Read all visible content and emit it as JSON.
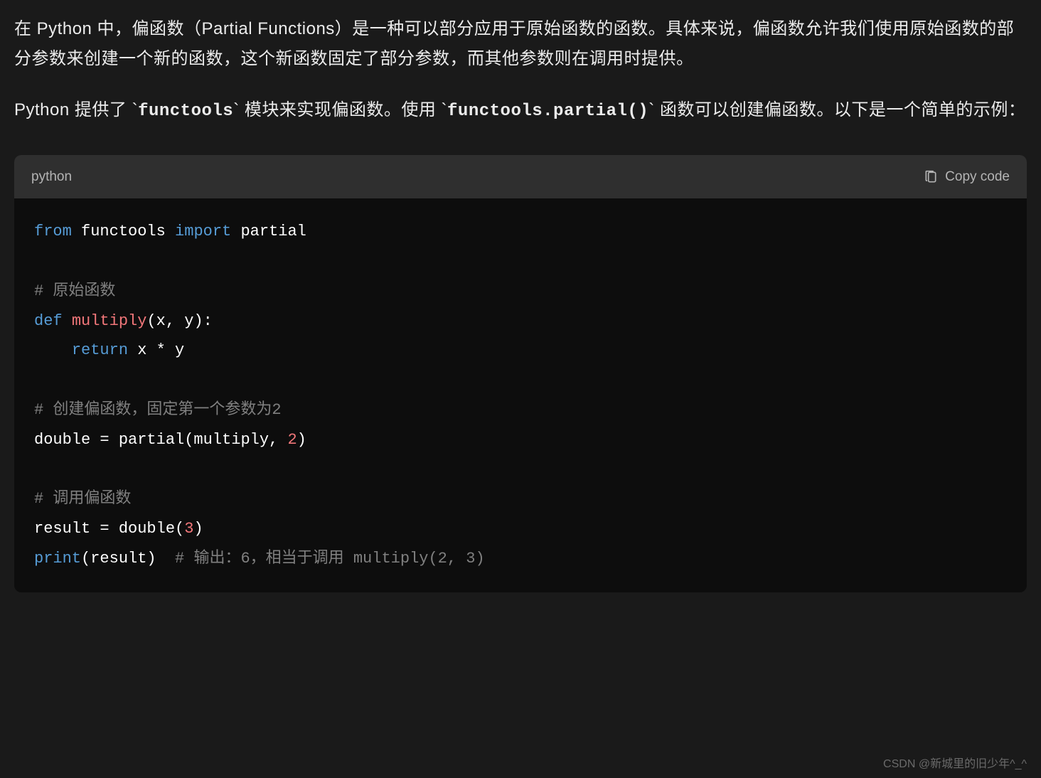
{
  "paragraphs": {
    "p1": "在 Python 中，偏函数（Partial Functions）是一种可以部分应用于原始函数的函数。具体来说，偏函数允许我们使用原始函数的部分参数来创建一个新的函数，这个新函数固定了部分参数，而其他参数则在调用时提供。",
    "p2_prefix": "Python 提供了 ",
    "p2_code1": "functools",
    "p2_mid1": " 模块来实现偏函数。使用 ",
    "p2_code2": "functools.partial()",
    "p2_suffix": " 函数可以创建偏函数。以下是一个简单的示例："
  },
  "code_block": {
    "language": "python",
    "copy_label": "Copy code",
    "tokens": {
      "from": "from",
      "module": " functools ",
      "import": "import",
      "partial_name": " partial",
      "comment1": "# 原始函数",
      "def": "def",
      "space1": " ",
      "fn_multiply": "multiply",
      "params": "(x, y):",
      "indent": "    ",
      "return": "return",
      "return_expr": " x * y",
      "comment2": "# 创建偏函数，固定第一个参数为2",
      "assign_double": "double = partial(multiply, ",
      "num2": "2",
      "close_paren1": ")",
      "comment3": "# 调用偏函数",
      "assign_result": "result = double(",
      "num3": "3",
      "close_paren2": ")",
      "print": "print",
      "print_args": "(result)  ",
      "comment4": "# 输出：6，相当于调用 multiply(2, 3)"
    }
  },
  "watermark": "CSDN @新城里的旧少年^_^"
}
